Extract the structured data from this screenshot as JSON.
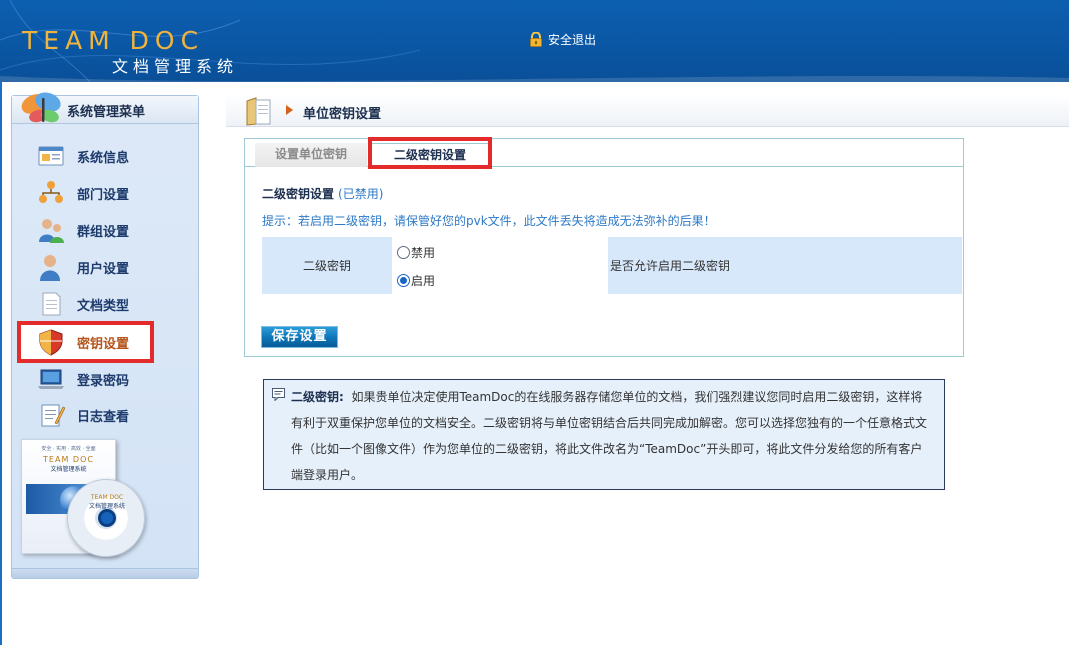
{
  "header": {
    "logo_en": "TEAM DOC",
    "logo_cn": "文档管理系统",
    "logout_label": "安全退出"
  },
  "sidebar": {
    "title": "系统管理菜单",
    "items": [
      {
        "label": "系统信息",
        "icon": "system-info-icon",
        "active": false
      },
      {
        "label": "部门设置",
        "icon": "org-chart-icon",
        "active": false
      },
      {
        "label": "群组设置",
        "icon": "group-icon",
        "active": false
      },
      {
        "label": "用户设置",
        "icon": "user-icon",
        "active": false
      },
      {
        "label": "文档类型",
        "icon": "document-icon",
        "active": false
      },
      {
        "label": "密钥设置",
        "icon": "shield-icon",
        "active": true
      },
      {
        "label": "登录密码",
        "icon": "laptop-icon",
        "active": false
      },
      {
        "label": "日志查看",
        "icon": "notepad-icon",
        "active": false
      }
    ],
    "product": {
      "top": "安全 · 实用 · 高效 · 全面",
      "en": "TEAM DOC",
      "cn": "文档管理系统",
      "disc_en": "TEAM DOC",
      "disc_cn": "文档管理系统"
    }
  },
  "breadcrumb": {
    "title": "单位密钥设置"
  },
  "tabs": [
    {
      "label": "设置单位密钥",
      "active": false
    },
    {
      "label": "二级密钥设置",
      "active": true
    }
  ],
  "form": {
    "section_title": "二级密钥设置",
    "section_state": "(已禁用)",
    "hint": "提示：若启用二级密钥，请保管好您的pvk文件，此文件丢失将造成无法弥补的后果！",
    "row_label": "二级密钥",
    "options": [
      {
        "label": "禁用",
        "checked": false
      },
      {
        "label": "启用",
        "checked": true
      }
    ],
    "row_desc": "是否允许启用二级密钥",
    "save_label": "保存设置"
  },
  "note": {
    "title": "二级密钥:",
    "text": "如果贵单位决定使用TeamDoc的在线服务器存储您单位的文档，我们强烈建议您同时启用二级密钥，这样将有利于双重保护您单位的文档安全。二级密钥将与单位密钥结合后共同完成加解密。您可以选择您独有的一个任意格式文件（比如一个图像文件）作为您单位的二级密钥，将此文件改名为“TeamDoc”开头即可，将此文件分发给您的所有客户端登录用户。"
  },
  "colors": {
    "header_blue": "#0a56a3",
    "accent_red": "#e32b2b",
    "link_blue": "#2d79c7",
    "cell_blue": "#d7e8fb"
  }
}
